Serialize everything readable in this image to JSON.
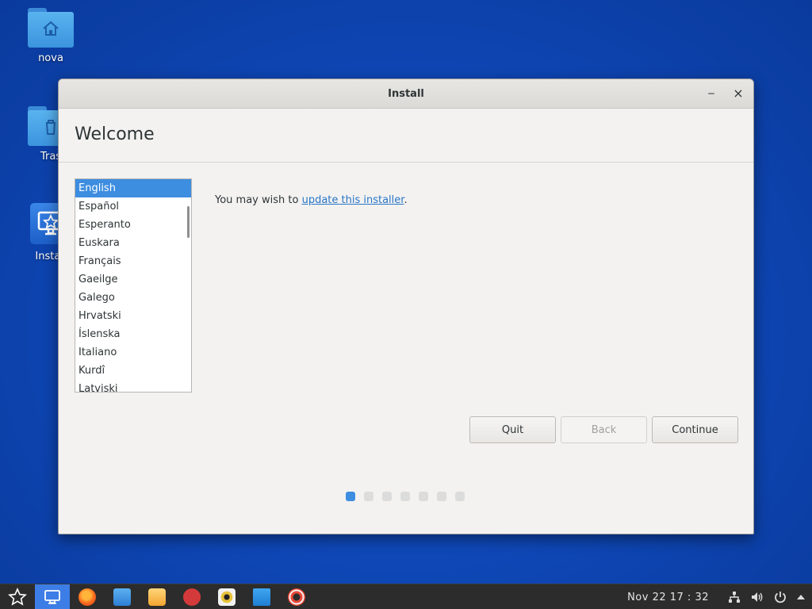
{
  "desktop": {
    "icons": [
      {
        "label": "nova"
      },
      {
        "label": "Tras"
      },
      {
        "label": "Install"
      }
    ]
  },
  "window": {
    "title": "Install",
    "minimize_glyph": "‒",
    "close_glyph": "×",
    "heading": "Welcome",
    "languages": [
      "English",
      "Español",
      "Esperanto",
      "Euskara",
      "Français",
      "Gaeilge",
      "Galego",
      "Hrvatski",
      "Íslenska",
      "Italiano",
      "Kurdî",
      "Latviski"
    ],
    "selected_language": "English",
    "message_prefix": "You may wish to ",
    "message_link": "update this installer",
    "message_suffix": ".",
    "buttons": {
      "quit": "Quit",
      "back": "Back",
      "continue": "Continue"
    },
    "progress": {
      "current_step": 1,
      "total_steps": 7
    }
  },
  "taskbar": {
    "apps": [
      "start-menu-icon",
      "installer-icon",
      "firefox-icon",
      "files-icon",
      "mail-icon",
      "chat-icon",
      "music-player-icon",
      "document-editor-icon",
      "help-icon"
    ],
    "clock": "Nov 22  17 : 32"
  },
  "colors": {
    "accent": "#3d8de0",
    "link": "#2a76c6",
    "desktop": "#0f48b8"
  }
}
